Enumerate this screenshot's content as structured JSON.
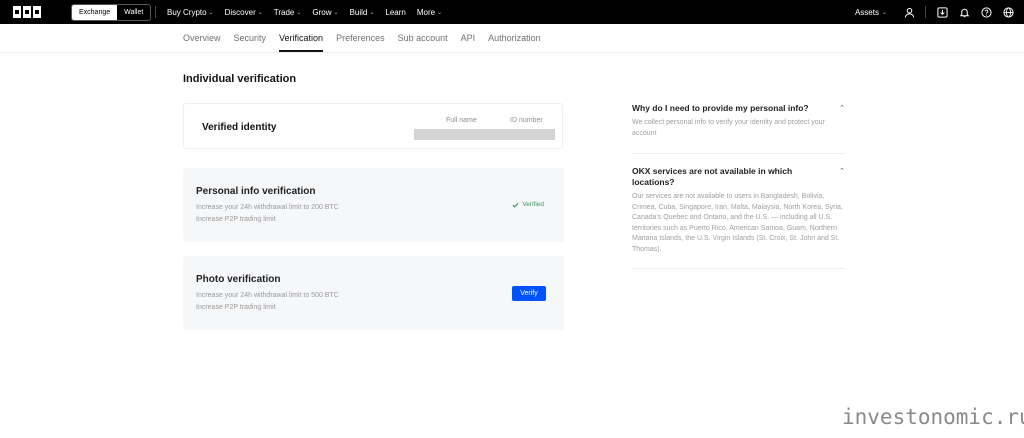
{
  "topbar": {
    "logo": "OKX",
    "toggle": [
      "Exchange",
      "Wallet"
    ],
    "menu": [
      {
        "label": "Buy Crypto",
        "has_dropdown": true
      },
      {
        "label": "Discover",
        "has_dropdown": true
      },
      {
        "label": "Trade",
        "has_dropdown": true
      },
      {
        "label": "Grow",
        "has_dropdown": true
      },
      {
        "label": "Build",
        "has_dropdown": true
      },
      {
        "label": "Learn",
        "has_dropdown": false
      },
      {
        "label": "More",
        "has_dropdown": true
      }
    ],
    "assets_label": "Assets",
    "icons": [
      "user-icon",
      "download-icon",
      "bell-icon",
      "help-icon",
      "globe-icon"
    ]
  },
  "subnav": {
    "tabs": [
      "Overview",
      "Security",
      "Verification",
      "Preferences",
      "Sub account",
      "API",
      "Authorization"
    ],
    "active": "Verification"
  },
  "main": {
    "title": "Individual verification",
    "identity": {
      "label": "Verified identity",
      "col_fullname": "Full name",
      "col_id": "ID number"
    },
    "personal": {
      "title": "Personal info verification",
      "line1": "Increase your 24h withdrawal limit to 200 BTC",
      "line2": "Increase P2P trading limit",
      "status": "Verified",
      "status_color": "#3a9a5a"
    },
    "photo": {
      "title": "Photo verification",
      "line1": "Increase your 24h withdrawal limit to 500 BTC",
      "line2": "Increase P2P trading limit",
      "button": "Verify",
      "button_color": "#0052ff"
    }
  },
  "faq": [
    {
      "question": "Why do I need to provide my personal info?",
      "answer": "We collect personal info to verify your identity and protect your account"
    },
    {
      "question": "OKX services are not available in which locations?",
      "answer": "Our services are not available to users in Bangladesh, Bolivia, Crimea, Cuba, Singapore, Iran, Malta, Malaysia, North Korea, Syria, Canada's Quebec and Ontario, and the U.S. — including all U.S. territories such as Puerto Rico, American Samoa, Guam, Northern Mariana Islands, the U.S. Virgin Islands (St. Croix, St. John and St. Thomas)."
    }
  ],
  "watermark": "investonomic.ru"
}
